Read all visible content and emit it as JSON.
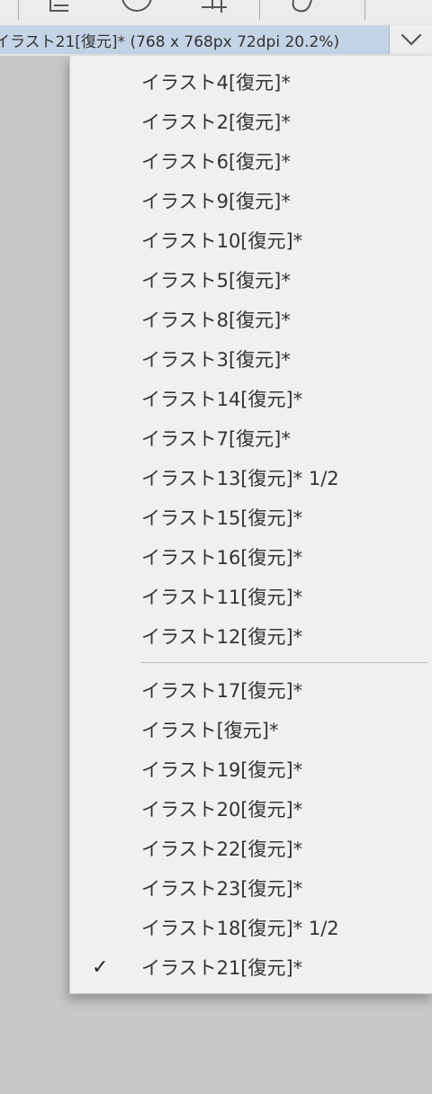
{
  "document_selector": {
    "current": "イラスト21[復元]* (768 x 768px 72dpi 20.2%)",
    "dropdown_icon": "chevron-down-icon"
  },
  "toolbar": {
    "icons": [
      "crop-icon",
      "circle-icon",
      "grid-icon",
      "chat-icon"
    ]
  },
  "menu": {
    "group1": [
      "イラスト4[復元]*",
      "イラスト2[復元]*",
      "イラスト6[復元]*",
      "イラスト9[復元]*",
      "イラスト10[復元]*",
      "イラスト5[復元]*",
      "イラスト8[復元]*",
      "イラスト3[復元]*",
      "イラスト14[復元]*",
      "イラスト7[復元]*",
      "イラスト13[復元]* 1/2",
      "イラスト15[復元]*",
      "イラスト16[復元]*",
      "イラスト11[復元]*",
      "イラスト12[復元]*"
    ],
    "group2": [
      "イラスト17[復元]*",
      "イラスト[復元]*",
      "イラスト19[復元]*",
      "イラスト20[復元]*",
      "イラスト22[復元]*",
      "イラスト23[復元]*",
      "イラスト18[復元]* 1/2",
      "イラスト21[復元]*"
    ],
    "checked_item": "イラスト21[復元]*",
    "check_glyph": "✓"
  },
  "colors": {
    "selector_bg": "#c3d4e6",
    "menu_bg": "#f0f0f0",
    "background": "#c8c8c8"
  }
}
